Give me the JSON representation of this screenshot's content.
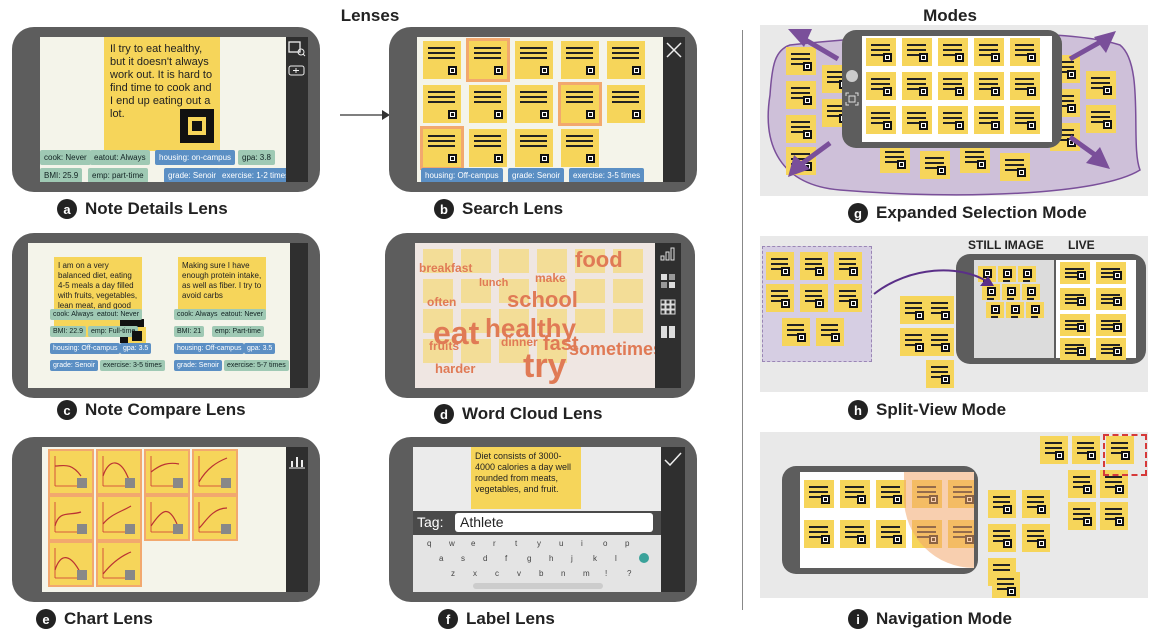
{
  "headings": {
    "lenses": "Lenses",
    "modes": "Modes"
  },
  "captions": [
    {
      "letter": "a",
      "label": "Note Details Lens"
    },
    {
      "letter": "b",
      "label": "Search Lens"
    },
    {
      "letter": "c",
      "label": "Note Compare Lens"
    },
    {
      "letter": "d",
      "label": "Word Cloud Lens"
    },
    {
      "letter": "e",
      "label": "Chart Lens"
    },
    {
      "letter": "f",
      "label": "Label Lens"
    },
    {
      "letter": "g",
      "label": "Expanded Selection Mode"
    },
    {
      "letter": "h",
      "label": "Split-View Mode"
    },
    {
      "letter": "i",
      "label": "Navigation Mode"
    }
  ],
  "note_a": {
    "text": "Il try to eat healthy, but it doesn't always work out. It is hard to find time to cook and I end up eating out a lot.",
    "tags": [
      "cook: Never",
      "eatout: Always",
      "housing: on-campus",
      "gpa: 3.8",
      "BMI: 25.9",
      "emp: part-time",
      "grade: Senoir",
      "exercise: 1-2 times"
    ]
  },
  "search_b": {
    "tags": [
      "housing: Off-campus",
      "grade: Senoir",
      "exercise: 3-5 times"
    ]
  },
  "compare_c": {
    "left_text": "I am on a very balanced diet, eating 4-5 meals a day filled with fruits, vegetables, lean meat, and good carbs.",
    "right_text": "Making sure I have enough protein intake, as well as fiber. I try to avoid carbs",
    "left_tags": [
      "cook: Always",
      "eatout: Never",
      "BMI: 22.9",
      "emp: Full-time",
      "housing: Off-campus",
      "gpa: 3.5",
      "grade: Senoir",
      "exercise: 3-5 times"
    ],
    "right_tags": [
      "cook: Always",
      "eatout: Never",
      "BMI: 21",
      "emp: Part-time",
      "housing: Off-campus",
      "gpa: 3.5",
      "grade: Senoir",
      "exercise: 5-7 times"
    ]
  },
  "wordcloud_d": {
    "words": [
      "food",
      "breakfast",
      "school",
      "often",
      "make",
      "lunch",
      "eat",
      "healthy",
      "fast",
      "fruits",
      "dinner",
      "sometimes",
      "harder",
      "try"
    ]
  },
  "label_f": {
    "note_text": "Diet consists of 3000-4000 calories a day well rounded from meats, vegetables, and fruit.",
    "tag_label": "Tag:",
    "tag_value": "Athlete",
    "keys_row1": [
      "q",
      "w",
      "e",
      "r",
      "t",
      "y",
      "u",
      "i",
      "o",
      "p"
    ],
    "keys_row2": [
      "a",
      "s",
      "d",
      "f",
      "g",
      "h",
      "j",
      "k",
      "l"
    ],
    "keys_row3": [
      "z",
      "x",
      "c",
      "v",
      "b",
      "n",
      "m",
      "!",
      "?"
    ]
  },
  "split_h": {
    "still_label": "STILL IMAGE",
    "live_label": "LIVE"
  },
  "colors": {
    "note": "#f6d55a",
    "phone": "#5d5d5d",
    "sidebar": "#2f2f2f",
    "tag_green": "#9fc9b4",
    "tag_blue": "#5b8fc4",
    "word_cloud": "#e07a55",
    "selection": "#b89fcc"
  }
}
